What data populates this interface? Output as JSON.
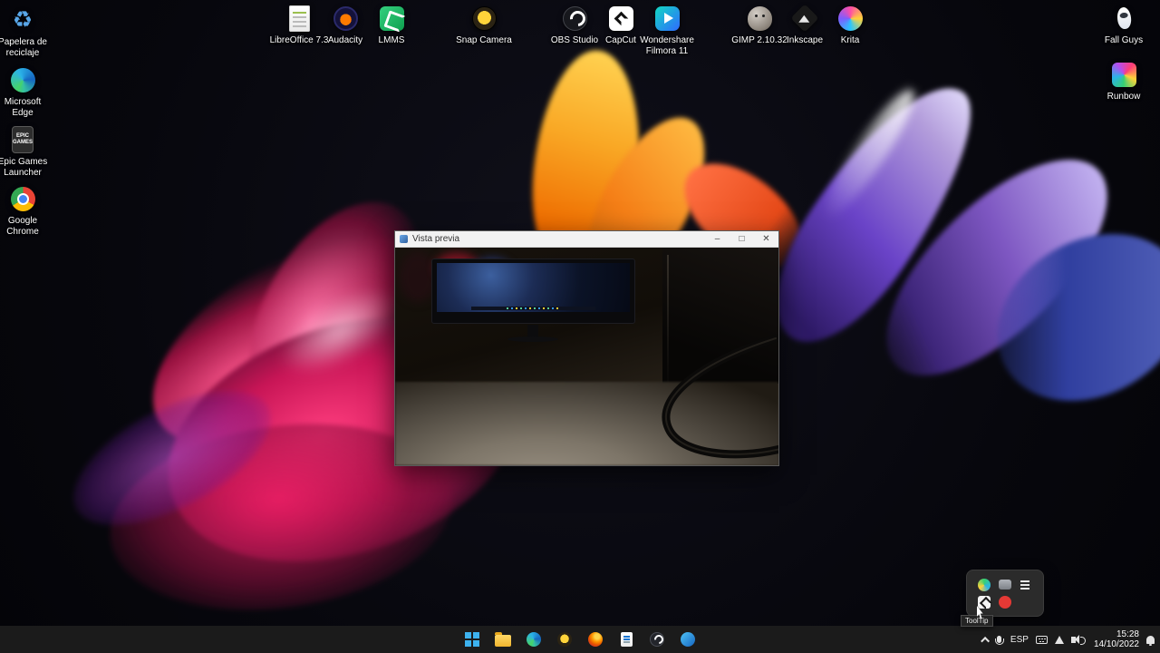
{
  "colors": {
    "taskbar_bg": "#1b1b1b",
    "wallpaper_pink": "#e51b62",
    "wallpaper_orange": "#f6a21d",
    "wallpaper_purple": "#7a3fd1",
    "window_titlebar_bg": "#f2f2f2",
    "flyout_bg": "#2b2b2b",
    "record_red": "#e53935",
    "start_blue": "#3db2ef"
  },
  "desktop_icons": {
    "left": [
      {
        "label": "Papelera de reciclaje",
        "icon": "recycle-bin-icon"
      },
      {
        "label": "Microsoft Edge",
        "icon": "edge-icon"
      },
      {
        "label": "Epic Games Launcher",
        "icon": "epic-games-icon"
      },
      {
        "label": "Google Chrome",
        "icon": "chrome-icon"
      }
    ],
    "top": [
      {
        "label": "LibreOffice 7.3",
        "icon": "libreoffice-icon"
      },
      {
        "label": "Audacity",
        "icon": "audacity-icon"
      },
      {
        "label": "LMMS",
        "icon": "lmms-icon"
      },
      {
        "label": "Snap Camera",
        "icon": "snap-camera-icon"
      },
      {
        "label": "OBS Studio",
        "icon": "obs-icon"
      },
      {
        "label": "CapCut",
        "icon": "capcut-icon"
      },
      {
        "label": "Wondershare Filmora 11",
        "icon": "filmora-icon"
      },
      {
        "label": "GIMP 2.10.32",
        "icon": "gimp-icon"
      },
      {
        "label": "Inkscape",
        "icon": "inkscape-icon"
      },
      {
        "label": "Krita",
        "icon": "krita-icon"
      }
    ],
    "right": [
      {
        "label": "Fall Guys",
        "icon": "fall-guys-icon"
      },
      {
        "label": "Runbow",
        "icon": "runbow-icon"
      }
    ],
    "epic_icon_text": "EPIC GAMES",
    "recycle_glyph": "♻"
  },
  "preview_window": {
    "title": "Vista previa",
    "minimize_label": "–",
    "maximize_label": "□",
    "close_label": "✕"
  },
  "tray_flyout": {
    "tooltip": "ToolTip"
  },
  "taskbar": {
    "language": "ESP",
    "time": "15:28",
    "date": "14/10/2022"
  }
}
